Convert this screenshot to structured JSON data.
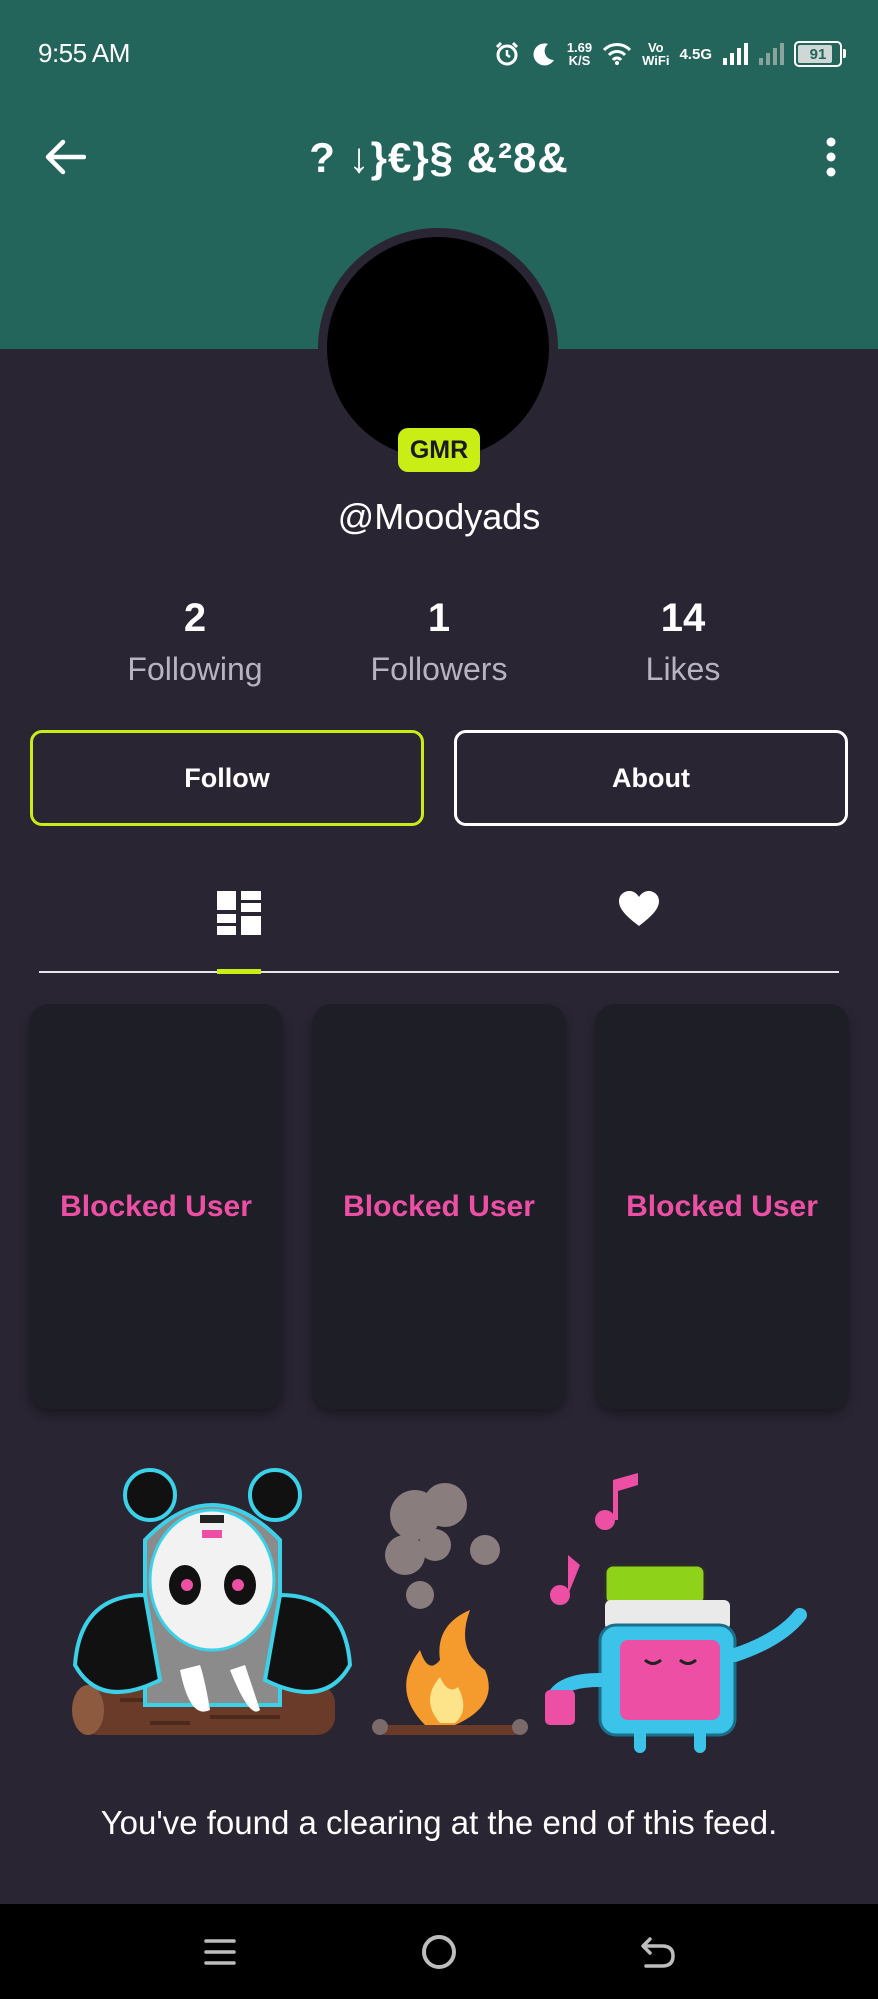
{
  "status_bar": {
    "time": "9:55 AM",
    "net_speed_value": "1.69",
    "net_speed_unit": "K/S",
    "volte_top": "Vo",
    "volte_bottom": "WiFi",
    "network_type": "4.5G",
    "battery": "91"
  },
  "header": {
    "title": "? ↓}€}§ &²8&"
  },
  "profile": {
    "badge": "GMR",
    "username": "@Moodyads"
  },
  "stats": [
    {
      "value": "2",
      "label": "Following"
    },
    {
      "value": "1",
      "label": "Followers"
    },
    {
      "value": "14",
      "label": "Likes"
    }
  ],
  "buttons": {
    "follow": "Follow",
    "about": "About"
  },
  "tabs": [
    {
      "icon": "grid-icon",
      "selected": true
    },
    {
      "icon": "heart-icon",
      "selected": false
    }
  ],
  "grid_items": [
    {
      "label": "Blocked User"
    },
    {
      "label": "Blocked User"
    },
    {
      "label": "Blocked User"
    }
  ],
  "footer": {
    "end_message": "You've found a clearing at the end of this feed."
  },
  "nav_bar": {
    "icons": [
      "menu-icon",
      "home-icon",
      "back-icon"
    ]
  },
  "colors": {
    "header_bg": "#23655b",
    "page_bg": "#2a2533",
    "accent": "#c8ee15",
    "blocked_text": "#ec4fa4",
    "card_bg": "#1d1e26"
  }
}
